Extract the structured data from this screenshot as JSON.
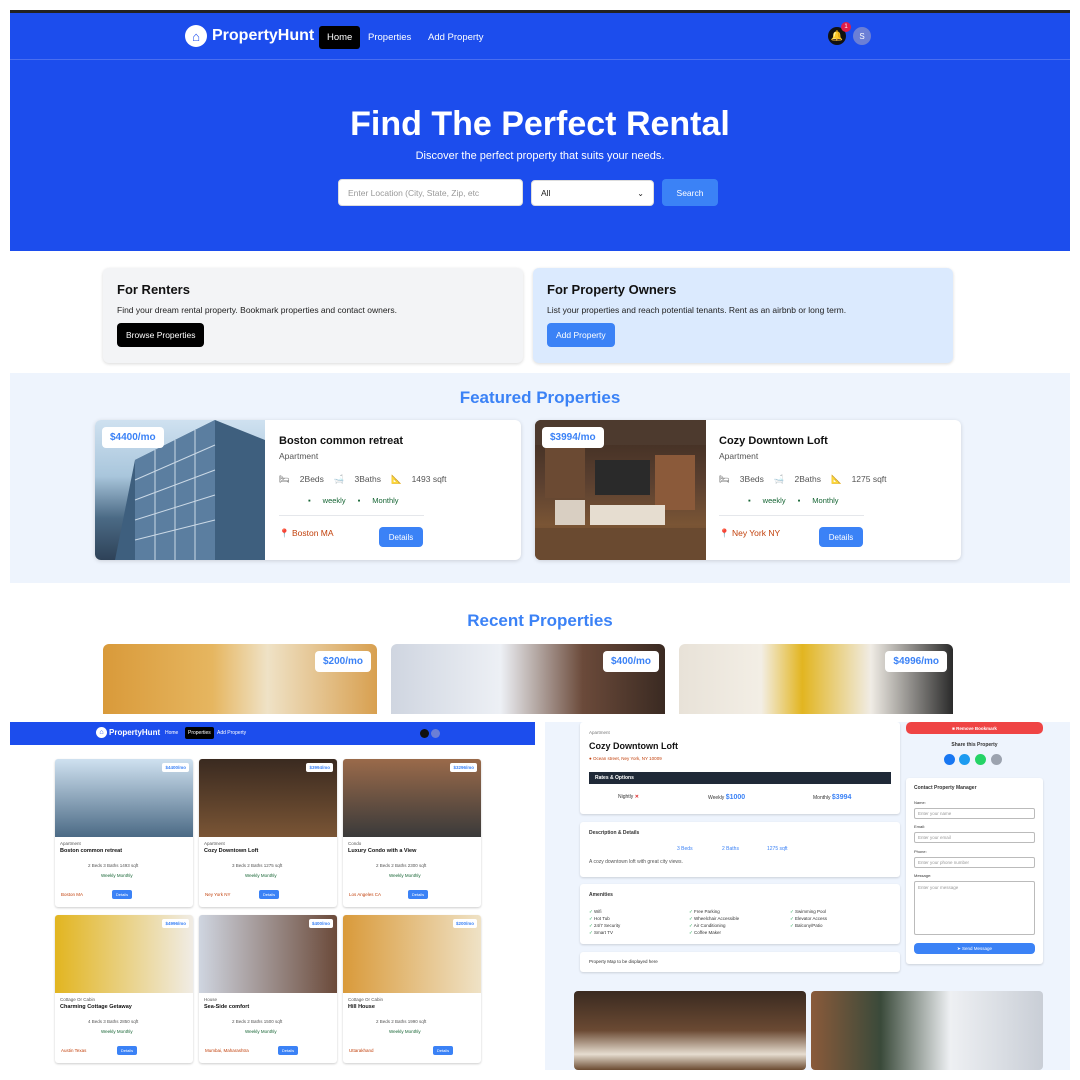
{
  "nav": {
    "brand": "PropertyHunt",
    "home": "Home",
    "properties": "Properties",
    "add": "Add Property",
    "badge": "1",
    "avatar": "S"
  },
  "hero": {
    "title": "Find The Perfect Rental",
    "subtitle": "Discover the perfect property that suits your needs.",
    "location_placeholder": "Enter Location (City, State, Zip, etc",
    "type_selected": "All",
    "search": "Search"
  },
  "renters": {
    "title": "For Renters",
    "text": "Find your dream rental property. Bookmark properties and contact owners.",
    "button": "Browse Properties"
  },
  "owners": {
    "title": "For Property Owners",
    "text": "List your properties and reach potential tenants. Rent as an airbnb or long term.",
    "button": "Add Property"
  },
  "featured": {
    "title": "Featured Properties",
    "items": [
      {
        "price": "$4400/mo",
        "name": "Boston common retreat",
        "type": "Apartment",
        "beds": "2Beds",
        "baths": "3Baths",
        "sqft": "1493 sqft",
        "tag1": "weekly",
        "tag2": "Monthly",
        "location": "Boston MA",
        "button": "Details"
      },
      {
        "price": "$3994/mo",
        "name": "Cozy Downtown Loft",
        "type": "Apartment",
        "beds": "3Beds",
        "baths": "2Baths",
        "sqft": "1275 sqft",
        "tag1": "weekly",
        "tag2": "Monthly",
        "location": "Ney York NY",
        "button": "Details"
      }
    ]
  },
  "recent": {
    "title": "Recent Properties",
    "prices": [
      "$200/mo",
      "$400/mo",
      "$4996/mo"
    ]
  },
  "mini_list": {
    "nav": {
      "brand": "PropertyHunt",
      "home": "Home",
      "properties": "Properties",
      "add": "Add Property"
    },
    "cards": [
      {
        "price": "$4400/mo",
        "type": "Apartment",
        "name": "Boston common retreat",
        "specs": "2 Beds   3 Baths   1493 sqft",
        "tags": "Weekly   Monthly",
        "loc": "Boston MA",
        "btn": "Details"
      },
      {
        "price": "$3994/mo",
        "type": "Apartment",
        "name": "Cozy Downtown Loft",
        "specs": "3 Beds   2 Baths   1275 sqft",
        "tags": "Weekly   Monthly",
        "loc": "Ney York NY",
        "btn": "Details"
      },
      {
        "price": "$3296/mo",
        "type": "Condo",
        "name": "Luxury Condo with a View",
        "specs": "2 Beds   2 Baths   2300 sqft",
        "tags": "Weekly   Monthly",
        "loc": "Los Angeles CA",
        "btn": "Details"
      },
      {
        "price": "$4996/mo",
        "type": "Cottage Or Cabin",
        "name": "Charming Cottage Getaway",
        "specs": "4 Beds   3 Baths   2850 sqft",
        "tags": "Weekly   Monthly",
        "loc": "Austin Texas",
        "btn": "Details"
      },
      {
        "price": "$400/mo",
        "type": "House",
        "name": "Sea-Side comfort",
        "specs": "2 Beds   2 Baths   1500 sqft",
        "tags": "Weekly   Monthly",
        "loc": "Mumbai, Maharashtra",
        "btn": "Details"
      },
      {
        "price": "$200/mo",
        "type": "Cottage Or Cabin",
        "name": "Hill House",
        "specs": "2 Beds   2 Baths   1990 sqft",
        "tags": "Weekly   Monthly",
        "loc": "Uttarakhand",
        "btn": "Details"
      }
    ]
  },
  "detail": {
    "type": "Apartment",
    "name": "Cozy Downtown Loft",
    "address": "Ocean street, Ney York, NY 10009",
    "rates_title": "Rates & Options",
    "nightly": "Nightly",
    "weekly": "Weekly",
    "weekly_val": "$1000",
    "monthly": "Monthly",
    "monthly_val": "$3994",
    "desc_title": "Description & Details",
    "beds": "3 Beds",
    "baths": "2 Baths",
    "sqft": "1275 sqft",
    "desc": "A cozy downtown loft with great city views.",
    "amen_title": "Amenities",
    "amenities": [
      "Wifi",
      "Hot Tub",
      "24/7 Security",
      "Smart TV",
      "Free Parking",
      "Wheelchair Accessible",
      "Air Conditioning",
      "Coffee Maker",
      "Swimming Pool",
      "Elevator Access",
      "Balcony/Patio"
    ],
    "map": "Property Map to be displayed here",
    "remove": "Remove Bookmark",
    "share": "Share this Property",
    "contact_title": "Contact Property Manager",
    "name_label": "Name:",
    "name_ph": "Enter your name",
    "email_label": "Email:",
    "email_ph": "Enter your email",
    "phone_label": "Phone:",
    "phone_ph": "Enter your phone number",
    "msg_label": "Message:",
    "msg_ph": "Enter your message",
    "send": "Send Message"
  }
}
